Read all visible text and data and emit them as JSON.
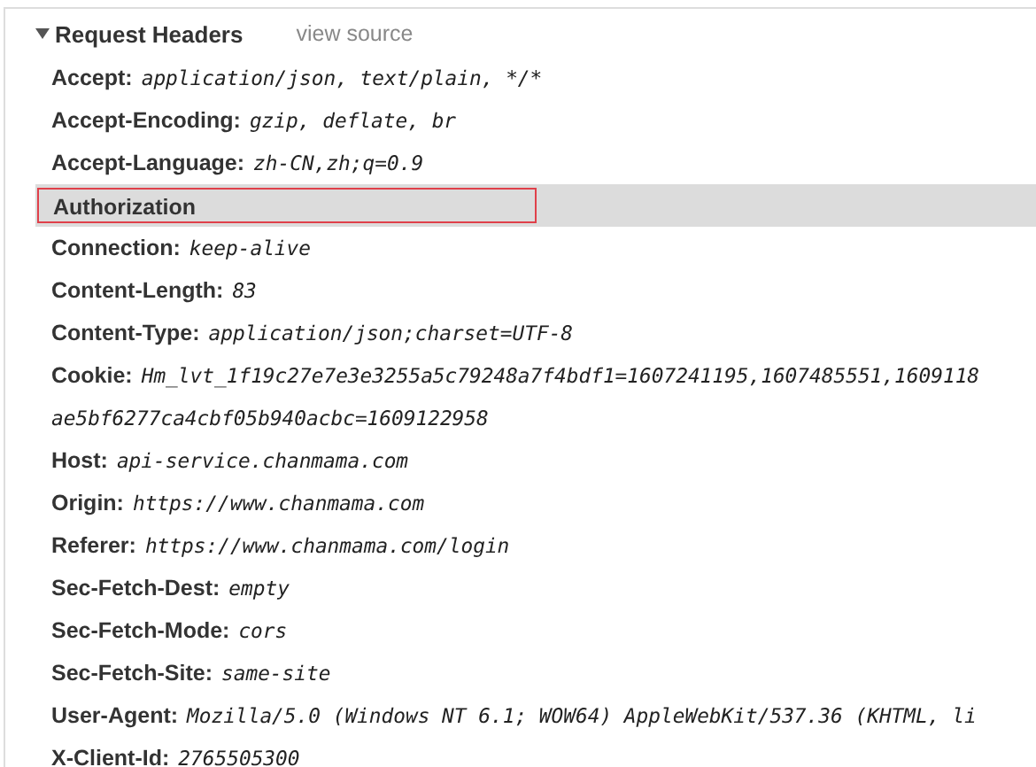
{
  "section": {
    "title": "Request Headers",
    "expanded": true,
    "link": "view source"
  },
  "headers": [
    {
      "name": "Accept:",
      "value_lines": [
        "application/json, text/plain, */*"
      ],
      "selected": false
    },
    {
      "name": "Accept-Encoding:",
      "value_lines": [
        "gzip, deflate, br"
      ],
      "selected": false
    },
    {
      "name": "Accept-Language:",
      "value_lines": [
        "zh-CN,zh;q=0.9"
      ],
      "selected": false
    },
    {
      "name": "Authorization",
      "selected": true
    },
    {
      "name": "Connection:",
      "value_lines": [
        "keep-alive"
      ],
      "selected": false
    },
    {
      "name": "Content-Length:",
      "value_lines": [
        "83"
      ],
      "selected": false
    },
    {
      "name": "Content-Type:",
      "value_lines": [
        "application/json;charset=UTF-8"
      ],
      "selected": false
    },
    {
      "name": "Cookie:",
      "value_lines": [
        "Hm_lvt_1f19c27e7e3e3255a5c79248a7f4bdf1=1607241195,1607485551,1609118",
        "ae5bf6277ca4cbf05b940acbc=1609122958"
      ],
      "selected": false
    },
    {
      "name": "Host:",
      "value_lines": [
        "api-service.chanmama.com"
      ],
      "selected": false
    },
    {
      "name": "Origin:",
      "value_lines": [
        "https://www.chanmama.com"
      ],
      "selected": false
    },
    {
      "name": "Referer:",
      "value_lines": [
        "https://www.chanmama.com/login"
      ],
      "selected": false
    },
    {
      "name": "Sec-Fetch-Dest:",
      "value_lines": [
        "empty"
      ],
      "selected": false
    },
    {
      "name": "Sec-Fetch-Mode:",
      "value_lines": [
        "cors"
      ],
      "selected": false
    },
    {
      "name": "Sec-Fetch-Site:",
      "value_lines": [
        "same-site"
      ],
      "selected": false
    },
    {
      "name": "User-Agent:",
      "value_lines": [
        "Mozilla/5.0 (Windows NT 6.1; WOW64) AppleWebKit/537.36 (KHTML, li"
      ],
      "selected": false
    },
    {
      "name": "X-Client-Id:",
      "value_lines": [
        "2765505300"
      ],
      "selected": false
    }
  ]
}
